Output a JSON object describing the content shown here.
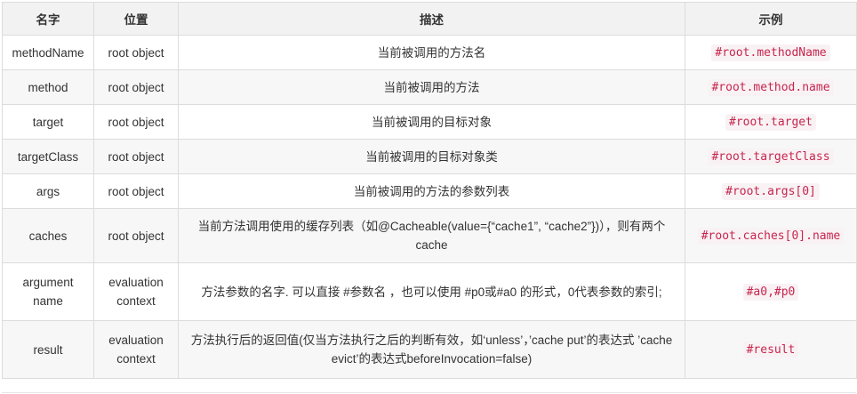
{
  "headers": [
    "名字",
    "位置",
    "描述",
    "示例"
  ],
  "rows": [
    {
      "name": "methodName",
      "location": "root object",
      "desc": "当前被调用的方法名",
      "example": "#root.methodName"
    },
    {
      "name": "method",
      "location": "root object",
      "desc": "当前被调用的方法",
      "example": "#root.method.name"
    },
    {
      "name": "target",
      "location": "root object",
      "desc": "当前被调用的目标对象",
      "example": "#root.target"
    },
    {
      "name": "targetClass",
      "location": "root object",
      "desc": "当前被调用的目标对象类",
      "example": "#root.targetClass"
    },
    {
      "name": "args",
      "location": "root object",
      "desc": "当前被调用的方法的参数列表",
      "example": "#root.args[0]"
    },
    {
      "name": "caches",
      "location": "root object",
      "desc": "当前方法调用使用的缓存列表（如@Cacheable(value={“cache1”, “cache2”})），则有两个cache",
      "example": "#root.caches[0].name"
    },
    {
      "name": "argument name",
      "location": "evaluation context",
      "desc": "方法参数的名字. 可以直接 #参数名 ，也可以使用 #p0或#a0 的形式，0代表参数的索引;",
      "example": "#a0,#p0"
    },
    {
      "name": "result",
      "location": "evaluation context",
      "desc": "方法执行后的返回值(仅当方法执行之后的判断有效，如‘unless’，’cache put’的表达式 ’cache evict’的表达式beforeInvocation=false)",
      "example": "#result"
    }
  ]
}
